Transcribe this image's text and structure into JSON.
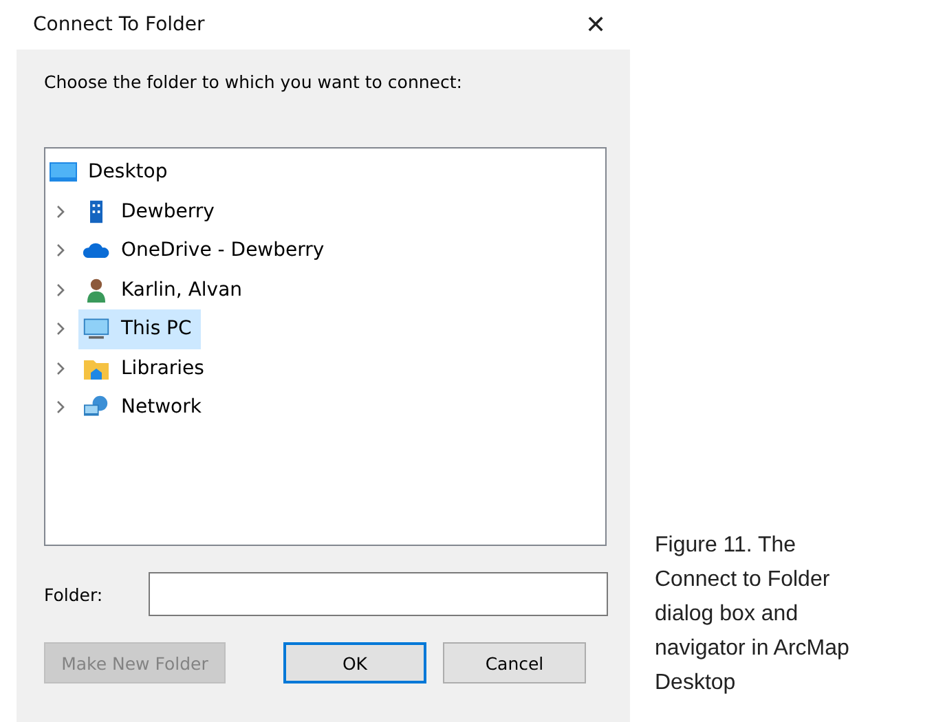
{
  "window": {
    "title": "Connect To Folder",
    "close": "✕"
  },
  "prompt": "Choose the folder to which you want to connect:",
  "tree": [
    {
      "label": "Desktop",
      "kind": "desktop",
      "selected": false,
      "children": [
        {
          "label": "Dewberry",
          "kind": "building",
          "selected": false,
          "expanded": false
        },
        {
          "label": "OneDrive - Dewberry",
          "kind": "cloud",
          "selected": false,
          "expanded": false
        },
        {
          "label": "Karlin, Alvan",
          "kind": "person",
          "selected": false,
          "expanded": false
        },
        {
          "label": "This PC",
          "kind": "monitor",
          "selected": true,
          "expanded": false
        },
        {
          "label": "Libraries",
          "kind": "folder",
          "selected": false,
          "expanded": false
        },
        {
          "label": "Network",
          "kind": "network",
          "selected": false,
          "expanded": false
        }
      ]
    }
  ],
  "folder_field": {
    "label": "Folder:"
  },
  "buttons": [
    {
      "label": "Make New Folder",
      "disabled": true,
      "default": false
    },
    {
      "label": "OK",
      "disabled": false,
      "default": true
    },
    {
      "label": "Cancel",
      "disabled": false,
      "default": false
    }
  ],
  "caption": "Figure 11. The Connect to Folder dialog box and navigator in ArcMap Desktop"
}
